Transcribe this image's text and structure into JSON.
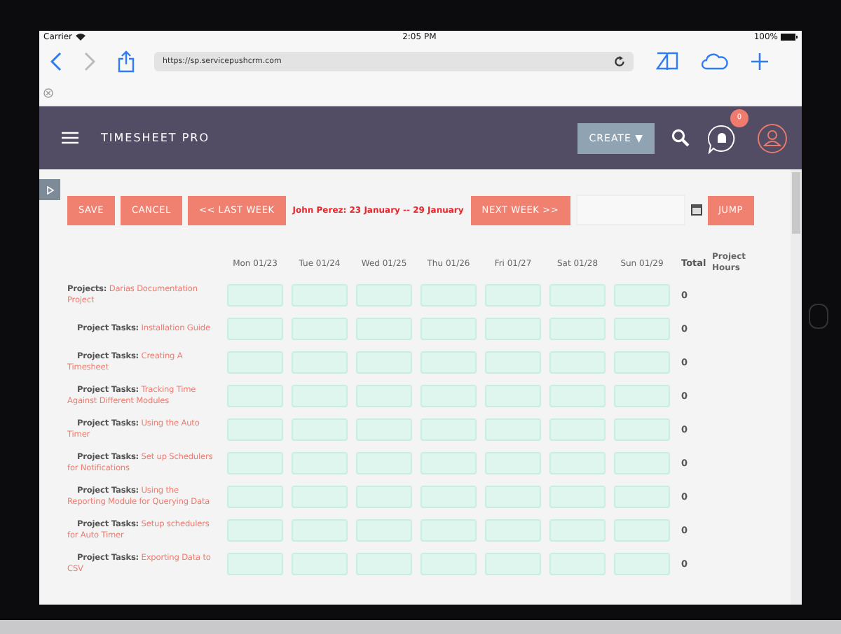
{
  "status_bar": {
    "carrier": "Carrier",
    "time": "2:05 PM",
    "battery": "100%"
  },
  "browser": {
    "url": "https://sp.servicepushcrm.com"
  },
  "header": {
    "title": "TIMESHEET PRO",
    "create_button": "CREATE ▼",
    "notifications": "0"
  },
  "toolbar": {
    "buttons": [
      "SAVE",
      "CANCEL",
      "<< LAST WEEK"
    ],
    "range": "John Perez: 23 January -- 29 January",
    "next": "NEXT WEEK >>",
    "jump": "JUMP"
  },
  "table": {
    "columns": [
      "Mon 01/23",
      "Tue 01/24",
      "Wed 01/25",
      "Thu 01/26",
      "Fri 01/27",
      "Sat 01/28",
      "Sun 01/29",
      "Total",
      "Project Hours"
    ],
    "rows": [
      {
        "kind": "project",
        "prefix": "Projects:",
        "name": "Darias Documentation Project",
        "total": "0"
      },
      {
        "kind": "task",
        "prefix": "Project Tasks:",
        "name": "Installation Guide",
        "total": "0"
      },
      {
        "kind": "task",
        "prefix": "Project Tasks:",
        "name": "Creating A Timesheet",
        "total": "0"
      },
      {
        "kind": "task",
        "prefix": "Project Tasks:",
        "name": "Tracking Time Against Different Modules",
        "total": "0"
      },
      {
        "kind": "task",
        "prefix": "Project Tasks:",
        "name": "Using the Auto Timer",
        "total": "0"
      },
      {
        "kind": "task",
        "prefix": "Project Tasks:",
        "name": "Set up Schedulers for Notifications",
        "total": "0"
      },
      {
        "kind": "task",
        "prefix": "Project Tasks:",
        "name": "Using the Reporting Module for Querying Data",
        "total": "0"
      },
      {
        "kind": "task",
        "prefix": "Project Tasks:",
        "name": "Setup schedulers for Auto Timer",
        "total": "0"
      },
      {
        "kind": "task",
        "prefix": "Project Tasks:",
        "name": "Exporting Data to CSV",
        "total": "0"
      }
    ]
  }
}
